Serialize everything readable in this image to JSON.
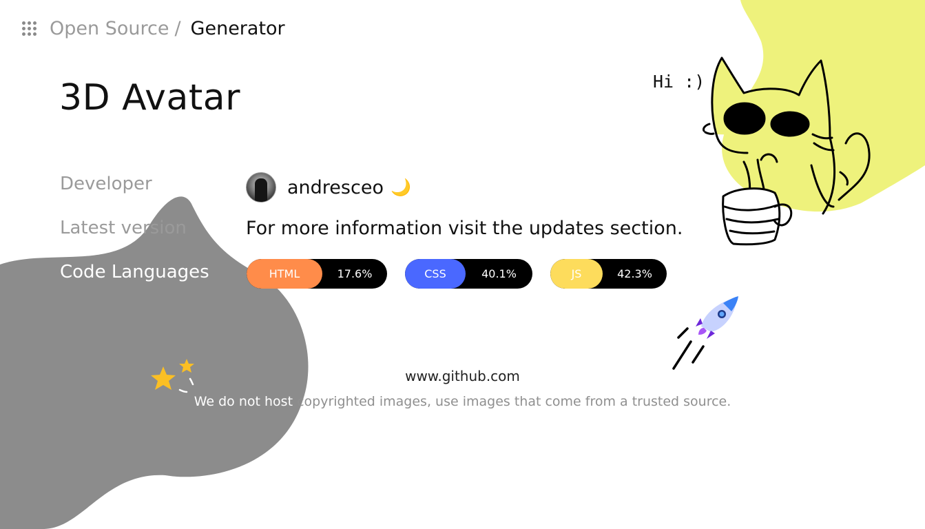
{
  "breadcrumb": {
    "parent": "Open Source",
    "separator": "/",
    "current": "Generator"
  },
  "title": "3D Avatar",
  "rows": {
    "developer_label": "Developer",
    "latest_label": "Latest version",
    "languages_label": "Code Languages"
  },
  "developer": {
    "name": "andresceo",
    "emoji": "🌙"
  },
  "latest_text": "For more information visit the updates section.",
  "languages": [
    {
      "name": "HTML",
      "percent": "17.6%",
      "color": "#ff8c4a"
    },
    {
      "name": "CSS",
      "percent": "40.1%",
      "color": "#4a68ff"
    },
    {
      "name": "JS",
      "percent": "42.3%",
      "color": "#fddc5c"
    }
  ],
  "footer": {
    "url": "www.github.com",
    "note_white": "We do not host",
    "note_grey": " copyrighted images, use images that come from a trusted source."
  },
  "illustration": {
    "speech": "Hi :)"
  },
  "colors": {
    "grey_blob": "#8c8c8c",
    "yellow_blob": "#eef27c"
  }
}
